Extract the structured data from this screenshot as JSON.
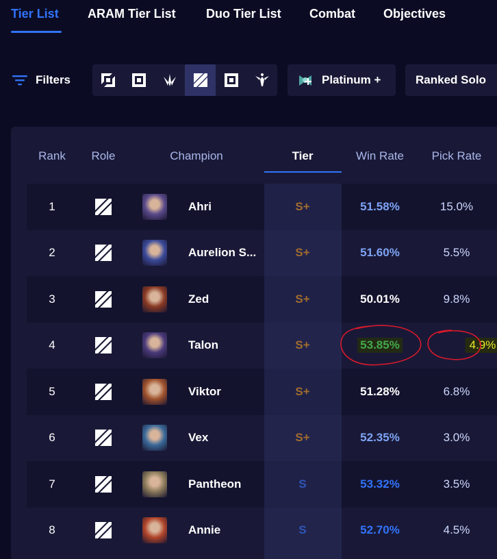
{
  "nav": {
    "tabs": [
      {
        "label": "Tier List",
        "active": true
      },
      {
        "label": "ARAM Tier List",
        "active": false
      },
      {
        "label": "Duo Tier List",
        "active": false
      },
      {
        "label": "Combat",
        "active": false
      },
      {
        "label": "Objectives",
        "active": false
      }
    ]
  },
  "filters": {
    "label": "Filters",
    "roles": [
      {
        "icon": "top-role-icon"
      },
      {
        "icon": "jungle-role-icon"
      },
      {
        "icon": "support-role-icon"
      },
      {
        "icon": "mid-role-icon",
        "active": true
      },
      {
        "icon": "bot-role-icon"
      },
      {
        "icon": "support-alt-role-icon"
      }
    ],
    "rank": "Platinum +",
    "queue": "Ranked Solo"
  },
  "table": {
    "headers": {
      "rank": "Rank",
      "role": "Role",
      "champion": "Champion",
      "tier": "Tier",
      "win_rate": "Win Rate",
      "pick_rate": "Pick Rate"
    },
    "rows": [
      {
        "rank": "1",
        "champion": "Ahri",
        "tier": "S+",
        "win_rate": "51.58%",
        "pick_rate": "15.0%",
        "win_color": "#7ea4f4",
        "portrait": "#5a4a8a"
      },
      {
        "rank": "2",
        "champion": "Aurelion S...",
        "tier": "S+",
        "win_rate": "51.60%",
        "pick_rate": "5.5%",
        "win_color": "#7ea4f4",
        "portrait": "#3b4a9a"
      },
      {
        "rank": "3",
        "champion": "Zed",
        "tier": "S+",
        "win_rate": "50.01%",
        "pick_rate": "9.8%",
        "win_color": "#ffffff",
        "portrait": "#8a3a24"
      },
      {
        "rank": "4",
        "champion": "Talon",
        "tier": "S+",
        "win_rate": "53.85%",
        "pick_rate": "4.9%",
        "win_color": "#44a84a",
        "portrait": "#4a3a7a",
        "highlight": true
      },
      {
        "rank": "5",
        "champion": "Viktor",
        "tier": "S+",
        "win_rate": "51.28%",
        "pick_rate": "6.8%",
        "win_color": "#ffffff",
        "portrait": "#a0522d"
      },
      {
        "rank": "6",
        "champion": "Vex",
        "tier": "S+",
        "win_rate": "52.35%",
        "pick_rate": "3.0%",
        "win_color": "#7ea4f4",
        "portrait": "#3a6a9a"
      },
      {
        "rank": "7",
        "champion": "Pantheon",
        "tier": "S",
        "win_rate": "53.32%",
        "pick_rate": "3.5%",
        "win_color": "#3273fa",
        "portrait": "#8a7a5a"
      },
      {
        "rank": "8",
        "champion": "Annie",
        "tier": "S",
        "win_rate": "52.70%",
        "pick_rate": "4.5%",
        "win_color": "#3273fa",
        "portrait": "#b0442a"
      }
    ]
  },
  "colors": {
    "accent": "#3273fa",
    "tier_s_plus": "#ff9b00",
    "tier_s": "#3273fa",
    "annotation_red": "#d8192b",
    "pick_highlight_text": "#e7ed2a"
  }
}
